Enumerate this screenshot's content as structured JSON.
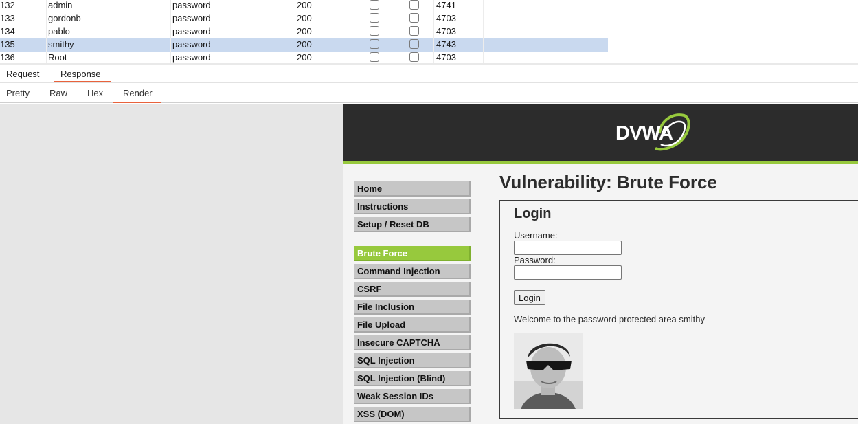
{
  "results": {
    "rows": [
      {
        "num": "132",
        "username": "admin",
        "password": "password",
        "status": "200",
        "length": "4741",
        "selected": false
      },
      {
        "num": "133",
        "username": "gordonb",
        "password": "password",
        "status": "200",
        "length": "4703",
        "selected": false
      },
      {
        "num": "134",
        "username": "pablo",
        "password": "password",
        "status": "200",
        "length": "4703",
        "selected": false
      },
      {
        "num": "135",
        "username": "smithy",
        "password": "password",
        "status": "200",
        "length": "4743",
        "selected": true
      },
      {
        "num": "136",
        "username": "Root",
        "password": "password",
        "status": "200",
        "length": "4703",
        "selected": false
      }
    ]
  },
  "message_tabs": [
    {
      "label": "Request",
      "active": false
    },
    {
      "label": "Response",
      "active": true
    }
  ],
  "view_tabs": [
    {
      "label": "Pretty",
      "active": false
    },
    {
      "label": "Raw",
      "active": false
    },
    {
      "label": "Hex",
      "active": false
    },
    {
      "label": "Render",
      "active": true
    }
  ],
  "dvwa": {
    "logo_text": "DVWA",
    "menu_top": [
      "Home",
      "Instructions",
      "Setup / Reset DB"
    ],
    "menu_vulns": [
      "Brute Force",
      "Command Injection",
      "CSRF",
      "File Inclusion",
      "File Upload",
      "Insecure CAPTCHA",
      "SQL Injection",
      "SQL Injection (Blind)",
      "Weak Session IDs",
      "XSS (DOM)"
    ],
    "active_menu": "Brute Force",
    "page_title": "Vulnerability: Brute Force",
    "login_heading": "Login",
    "username_label": "Username:",
    "password_label": "Password:",
    "username_value": "",
    "password_value": "",
    "login_button": "Login",
    "welcome_text": "Welcome to the password protected area smithy"
  },
  "colors": {
    "accent_tab": "#e8623c",
    "dvwa_green": "#97c93d",
    "dvwa_header": "#2c2c2c",
    "selected_row": "#c9d9ef"
  }
}
